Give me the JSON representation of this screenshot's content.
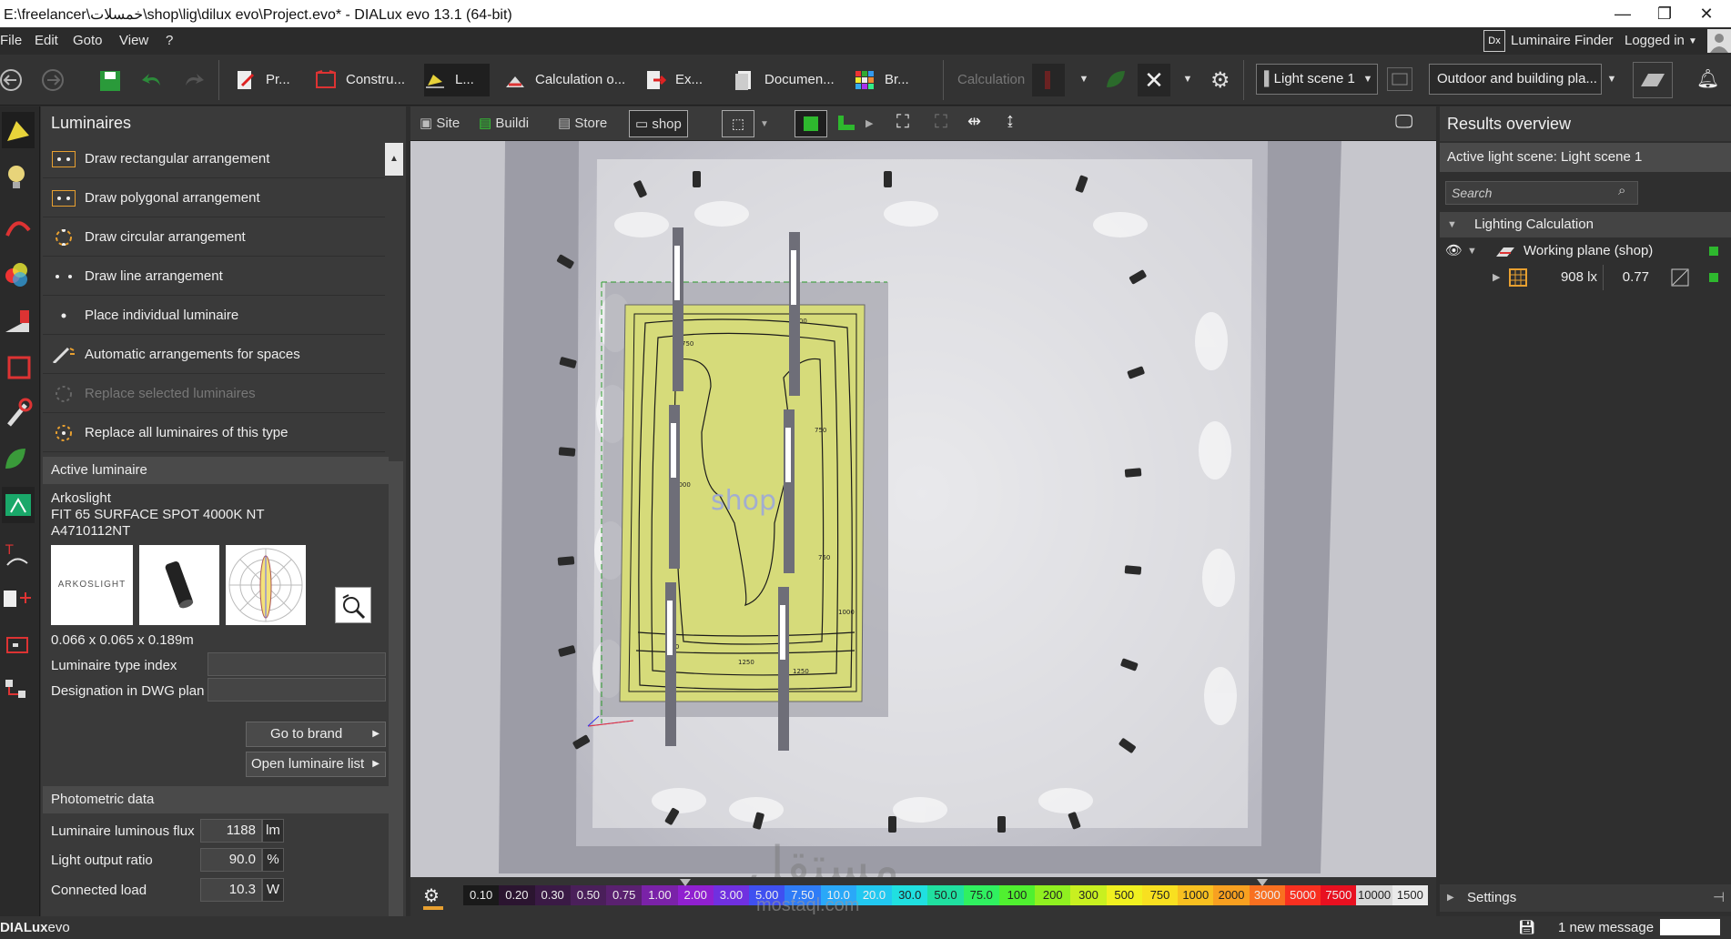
{
  "window": {
    "title": "E:\\freelancer\\خمسلات\\shop\\lig\\dilux evo\\Project.evo* - DIALux evo 13.1  (64-bit)",
    "minimize": "—",
    "restore": "❐",
    "close": "✕"
  },
  "menu": {
    "items": [
      "File",
      "Edit",
      "Goto",
      "View",
      "?"
    ],
    "luminaire_finder": "Luminaire Finder",
    "logged_in": "Logged in"
  },
  "toolbar": {
    "tabs": [
      "Pr...",
      "Constru...",
      "L...",
      "Calculation o...",
      "Ex...",
      "Documen...",
      "Br..."
    ],
    "calculation": "Calculation",
    "light_scene": "Light scene 1",
    "outdoor": "Outdoor and building pla..."
  },
  "left_panel": {
    "title": "Luminaires",
    "arrangements": [
      "Draw rectangular arrangement",
      "Draw polygonal arrangement",
      "Draw circular arrangement",
      "Draw line arrangement",
      "Place individual luminaire",
      "Automatic arrangements for spaces",
      "Replace selected luminaires",
      "Replace all luminaires of this type"
    ],
    "active_luminaire": {
      "header": "Active luminaire",
      "brand": "Arkoslight",
      "name": "FIT 65 SURFACE SPOT 4000K NT",
      "code": "A4710112NT",
      "logo_text": "ARKOSLIGHT",
      "dimensions": "0.066 x 0.065 x 0.189m",
      "type_index_label": "Luminaire type index",
      "dwg_label": "Designation in DWG plan",
      "go_to_brand": "Go to brand",
      "open_list": "Open luminaire list"
    },
    "photometric": {
      "header": "Photometric data",
      "rows": [
        {
          "label": "Luminaire luminous flux",
          "value": "1188",
          "unit": "lm"
        },
        {
          "label": "Light output ratio",
          "value": "90.0",
          "unit": "%"
        },
        {
          "label": "Connected load",
          "value": "10.3",
          "unit": "W"
        }
      ]
    }
  },
  "view": {
    "tabs": [
      "Site",
      "Buildi",
      "Store",
      "shop"
    ],
    "room_label": "shop",
    "contours": [
      "1000",
      "750",
      "1250",
      "750",
      "1000",
      "750",
      "1250",
      "1000",
      "750"
    ],
    "scale": [
      "0.10",
      "0.20",
      "0.30",
      "0.50",
      "0.75",
      "1.00",
      "2.00",
      "3.00",
      "5.00",
      "7.50",
      "10.0",
      "20.0",
      "30.0",
      "50.0",
      "75.0",
      "100",
      "200",
      "300",
      "500",
      "750",
      "1000",
      "2000",
      "3000",
      "5000",
      "7500",
      "10000",
      "1500"
    ],
    "scale_colors": [
      "#1a1a1a",
      "#2b1530",
      "#3a1a45",
      "#4a1f5a",
      "#5a2170",
      "#7a22a8",
      "#9020d0",
      "#7030e0",
      "#3f50f0",
      "#2f7cf6",
      "#2aa8f8",
      "#22c8f0",
      "#20e0e0",
      "#20e0a0",
      "#30f060",
      "#50f030",
      "#90f020",
      "#c8f020",
      "#f0f020",
      "#f8e020",
      "#f8c020",
      "#f8a020",
      "#f87020",
      "#f83020",
      "#e81020",
      "#d8d8d8",
      "#eaeaea"
    ]
  },
  "right_panel": {
    "title": "Results overview",
    "active_scene": "Active light scene: Light scene 1",
    "search_placeholder": "Search",
    "group": "Lighting Calculation",
    "item": "Working plane (shop)",
    "value": "908 lx",
    "uniformity": "0.77",
    "settings": "Settings"
  },
  "status": {
    "brand_bold": "DIALux",
    "brand_rest": "evo",
    "message": "1 new message"
  },
  "watermark": {
    "arabic": "مستقل",
    "latin": "mostaql.com"
  }
}
